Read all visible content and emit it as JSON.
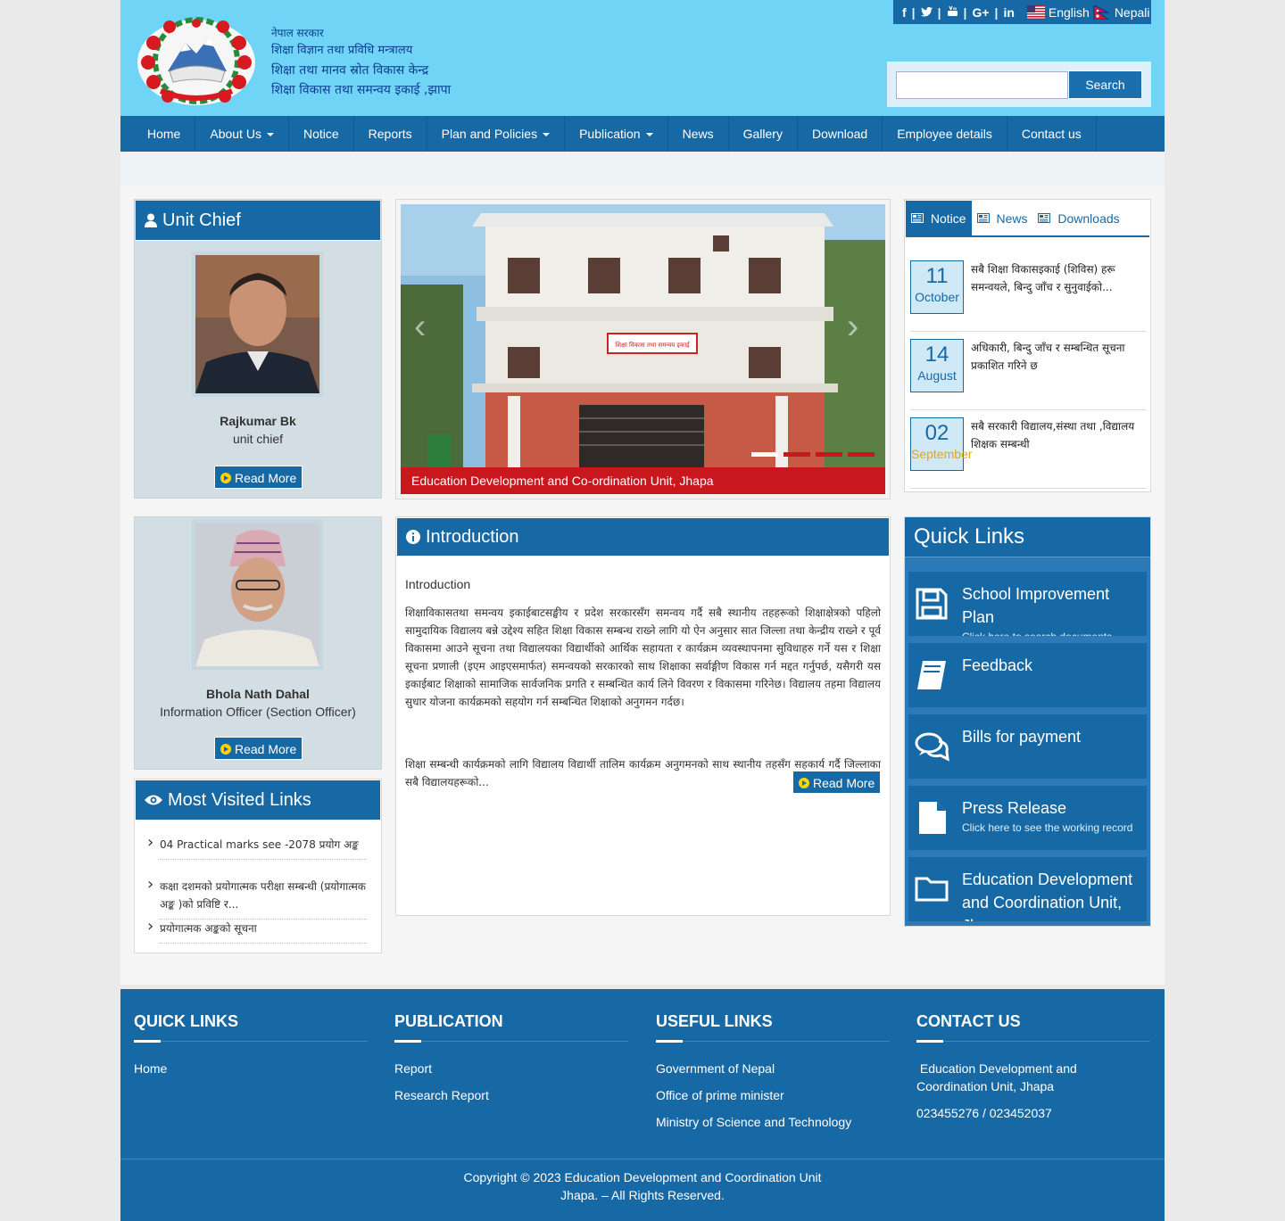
{
  "header": {
    "lines": [
      "नेपाल सरकार",
      "शिक्षा विज्ञान तथा प्रविधि मन्त्रालय",
      "शिक्षा तथा मानव स्रोत विकास केन्द्र",
      "शिक्षा विकास तथा समन्वय इकाई ,झापा"
    ],
    "social_icons": [
      "facebook-icon",
      "twitter-icon",
      "youtube-icon",
      "google-plus-icon",
      "linkedin-icon"
    ],
    "lang_english": "English",
    "lang_nepali": "Nepali",
    "search_placeholder": "",
    "search_button": "Search"
  },
  "nav": {
    "items": [
      {
        "label": "Home",
        "dropdown": false
      },
      {
        "label": "About Us",
        "dropdown": true
      },
      {
        "label": "Notice",
        "dropdown": false
      },
      {
        "label": "Reports",
        "dropdown": false
      },
      {
        "label": "Plan and Policies",
        "dropdown": true
      },
      {
        "label": "Publication",
        "dropdown": true
      },
      {
        "label": "News",
        "dropdown": false
      },
      {
        "label": "Gallery",
        "dropdown": false
      },
      {
        "label": "Download",
        "dropdown": false
      },
      {
        "label": "Employee details",
        "dropdown": false
      },
      {
        "label": "Contact us",
        "dropdown": false
      }
    ]
  },
  "unit_chief": {
    "heading": "Unit Chief",
    "name": "Rajkumar Bk",
    "position": "unit chief",
    "read_more": "Read More"
  },
  "info_officer": {
    "name": "Bhola Nath Dahal",
    "position": "Information Officer (Section Officer)",
    "read_more": "Read More"
  },
  "slider": {
    "caption": "Education Development and Co-ordination Unit, Jhapa",
    "sign_text": "शिक्षा विकास तथा समन्वय इकाई",
    "dots": 4,
    "active_dot": 0
  },
  "tabs": {
    "items": [
      "Notice",
      "News",
      "Downloads"
    ],
    "active": 0
  },
  "notices": [
    {
      "day": "11",
      "month": "October",
      "text": "सबै शिक्षा विकासइकाई (शिविस) हरू समन्वयले, बिन्दु जाँच र सुनुवाईको..."
    },
    {
      "day": "14",
      "month": "August",
      "text": "अधिकारी, बिन्दु जाँच र सम्बन्धित सूचना प्रकाशित गरिने छ"
    },
    {
      "day": "02",
      "month": "September",
      "text": "सबै सरकारी विद्यालय,संस्था तथा ,विद्यालय शिक्षक सम्बन्धी"
    }
  ],
  "intro": {
    "heading": "Introduction",
    "subtitle": "Introduction",
    "para1": "शिक्षाविकासतथा समन्वय इकाईबाटसङ्घीय र प्रदेश सरकारसँग समन्वय गर्दै सबै स्थानीय तहहरूको शिक्षाक्षेत्रको पहिलो सामुदायिक विद्यालय बन्ने उद्देश्य सहित शिक्षा विकास सम्बन्ध राख्ने लागि यो ऐन अनुसार सात जिल्ला तथा केन्द्रीय राख्ने र पूर्व विकासमा आउने सूचना तथा विद्यालयका विद्यार्थीको आर्थिक सहायता र कार्यक्रम व्यवस्थापनमा सुविधाहरु गर्ने यस र शिक्षा सूचना प्रणाली (इएम आइएसमार्फत) समन्वयको सरकारको साथ शिक्षाका सर्वाङ्गीण विकास गर्न मद्दत गर्नुपर्छ, यसैगरी यस इकाईबाट शिक्षाको सामाजिक सार्वजनिक प्रगति र सम्बन्धित कार्य लिने विवरण र विकासमा गरिनेछ। विद्यालय तहमा विद्यालय सुधार योजना कार्यक्रमको सहयोग गर्न सम्बन्धित शिक्षाको अनुगमन गर्दछ।",
    "para2": "शिक्षा सम्बन्धी कार्यक्रमको लागि विद्यालय विद्यार्थी तालिम कार्यक्रम अनुगमनको साथ स्थानीय तहसँग सहकार्य गर्दै जिल्लाका सबै विद्यालयहरूको...",
    "read_more": "Read More"
  },
  "most_visited": {
    "heading": "Most Visited Links",
    "links": [
      "04 Practical marks see -2078 प्रयोग अङ्क",
      "कक्षा दशमको प्रयोगात्मक परीक्षा सम्बन्धी (प्रयोगात्मक अङ्क )को प्रविष्टि र...",
      "प्रयोगात्मक अङ्कको सूचना"
    ]
  },
  "quick_links": {
    "heading": "Quick Links",
    "items": [
      {
        "title": "School Improvement Plan",
        "sub": "Click here to search documents",
        "icon": "save-icon"
      },
      {
        "title": "Feedback",
        "sub": "",
        "icon": "book-icon"
      },
      {
        "title": "Bills for payment",
        "sub": "",
        "icon": "comments-icon"
      },
      {
        "title": "Press Release",
        "sub": "Click here to see the working record",
        "icon": "file-icon"
      },
      {
        "title": "Education Development and Coordination Unit, Jhapa",
        "sub": "",
        "icon": "folder-icon"
      }
    ]
  },
  "footer": {
    "quick_links": {
      "heading": "QUICK LINKS",
      "items": [
        "Home"
      ]
    },
    "publication": {
      "heading": "PUBLICATION",
      "items": [
        "Report",
        "Research Report"
      ]
    },
    "useful_links": {
      "heading": "USEFUL LINKS",
      "items": [
        "Government of Nepal",
        "Office of prime minister",
        "Ministry of Science and Technology"
      ]
    },
    "contact": {
      "heading": "CONTACT US",
      "address": " Education Development and Coordination Unit, Jhapa",
      "phone": "023455276 / 023452037"
    },
    "copyright_line1": "Copyright © 2023 Education Development and Coordination Unit",
    "copyright_line2": "Jhapa. – All Rights Reserved."
  },
  "colors": {
    "header_bg": "#6fd4f5",
    "primary": "#1769a6",
    "accent_yellow": "#ffd400"
  }
}
